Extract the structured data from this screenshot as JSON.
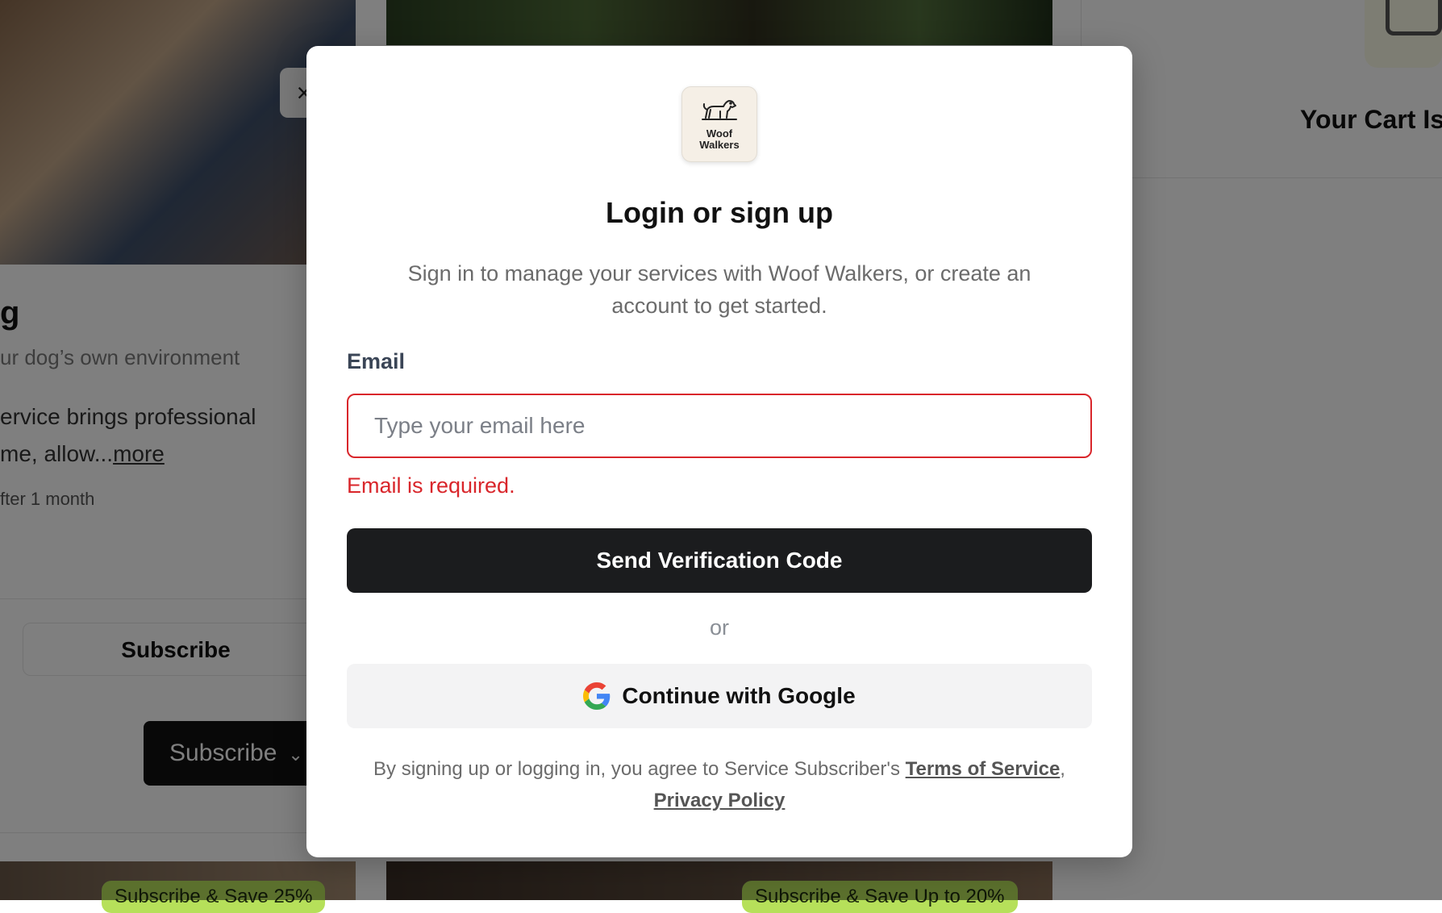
{
  "background": {
    "service": {
      "title_fragment": "g",
      "subtitle": "ur dog’s own environment",
      "description_line1": "ervice brings professional",
      "description_line2": "me, allow...",
      "more_link": "more",
      "note": "fter 1 month",
      "subscribe_outline_label": "Subscribe",
      "subscribe_dark_label": "Subscribe"
    },
    "badges": [
      "Subscribe & Save 25%",
      "Subscribe & Save Up to 20%"
    ],
    "cart_title": "Your Cart Is",
    "photo_close_icon": "×"
  },
  "modal": {
    "logo_text_line1": "Woof",
    "logo_text_line2": "Walkers",
    "title": "Login or sign up",
    "description": "Sign in to manage your services with Woof Walkers, or create an account to get started.",
    "email_label": "Email",
    "email_placeholder": "Type your email here",
    "email_value": "",
    "error_text": "Email is required.",
    "primary_button": "Send Verification Code",
    "or_text": "or",
    "google_button": "Continue with Google",
    "legal_prefix": "By signing up or logging in, you agree to Service Subscriber's ",
    "terms_link": "Terms of Service",
    "legal_sep": ",",
    "privacy_link": "Privacy Policy"
  },
  "colors": {
    "error": "#d9262b",
    "primary_button": "#1b1c1e",
    "badge": "#b6e05a",
    "overlay": "rgba(0,0,0,0.5)"
  }
}
